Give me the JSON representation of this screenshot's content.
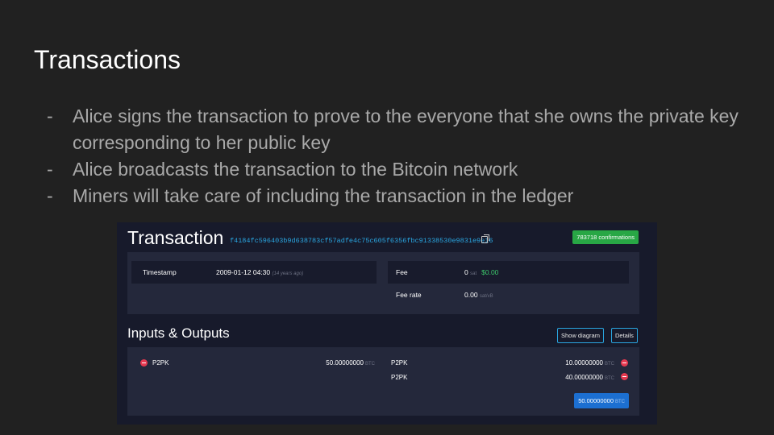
{
  "slide": {
    "title": "Transactions",
    "bullets": [
      "Alice signs the transaction to prove to the everyone that she owns the private key corresponding to her public key",
      "Alice broadcasts the transaction to the Bitcoin network",
      "Miners will take care of including the transaction in the ledger"
    ],
    "bullet_marker": "-"
  },
  "screenshot": {
    "title": "Transaction",
    "txid": "f4184fc596403b9d638783cf57adfe4c75c605f6356fbc91338530e9831e9e16",
    "confirmations": "783718 confirmations",
    "timestamp_label": "Timestamp",
    "timestamp_value": "2009-01-12 04:30",
    "timestamp_ago": "(14 years ago)",
    "fee_label": "Fee",
    "fee_value": "0",
    "fee_unit": "sat",
    "fee_usd": "$0.00",
    "feerate_label": "Fee rate",
    "feerate_value": "0.00",
    "feerate_unit": "sat/vB",
    "io_title": "Inputs & Outputs",
    "show_diagram": "Show diagram",
    "details": "Details",
    "input": {
      "type": "P2PK",
      "amount": "50.00000000",
      "unit": "BTC"
    },
    "outputs": [
      {
        "type": "P2PK",
        "amount": "10.00000000",
        "unit": "BTC"
      },
      {
        "type": "P2PK",
        "amount": "40.00000000",
        "unit": "BTC"
      }
    ],
    "total_amount": "50.00000000",
    "total_unit": "BTC",
    "colors": {
      "link": "#2aa6e0",
      "confirm": "#28a745",
      "usd": "#3cc56a",
      "arrow": "#e53950",
      "total": "#1c6fd1"
    }
  }
}
